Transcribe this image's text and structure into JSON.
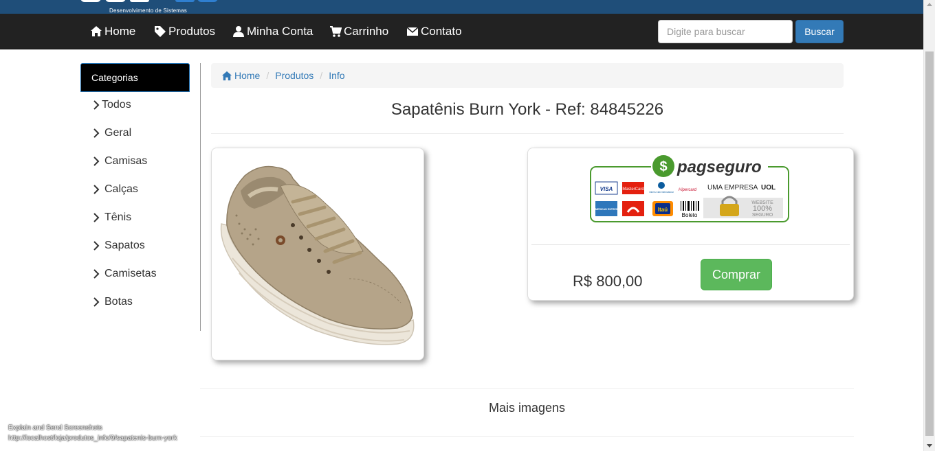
{
  "brand": {
    "subtitle": "Desenvolvimento de Sistemas",
    "color": "#1f4e79"
  },
  "nav": {
    "items": [
      {
        "label": "Home",
        "icon": "home-icon"
      },
      {
        "label": "Produtos",
        "icon": "tag-icon"
      },
      {
        "label": "Minha Conta",
        "icon": "user-icon"
      },
      {
        "label": "Carrinho",
        "icon": "cart-icon"
      },
      {
        "label": "Contato",
        "icon": "envelope-icon"
      }
    ],
    "search_placeholder": "Digite para buscar",
    "search_button": "Buscar"
  },
  "sidebar": {
    "header": "Categorias",
    "items": [
      "Todos",
      "Geral",
      "Camisas",
      "Calças",
      "Tênis",
      "Sapatos",
      "Camisetas",
      "Botas"
    ]
  },
  "breadcrumb": [
    "Home",
    "Produtos",
    "Info"
  ],
  "product": {
    "title": "Sapatênis Burn York - Ref: 84845226",
    "price": "R$ 800,00",
    "buy_label": "Comprar"
  },
  "payment": {
    "brand": "pagseguro",
    "tagline": "UMA EMPRESA",
    "tagline_brand": "UOL",
    "cards": [
      "VISA",
      "MasterCard",
      "Diners Club International",
      "Hipercard",
      "AMERICAN EXPRESS",
      "Itaú",
      "Boleto"
    ],
    "seal": [
      "WEBSITE",
      "100%",
      "SEGURO"
    ],
    "accent": "#4a9a2e"
  },
  "section": {
    "more_images": "Mais imagens"
  },
  "overlay": {
    "line1": "Explain and Send Screenshots",
    "line2": "http://localhost/loja/produtos_info/9/sapatenis-burn-york"
  },
  "colors": {
    "navbar": "#222222",
    "primary": "#337ab7",
    "success": "#5cb85c"
  }
}
